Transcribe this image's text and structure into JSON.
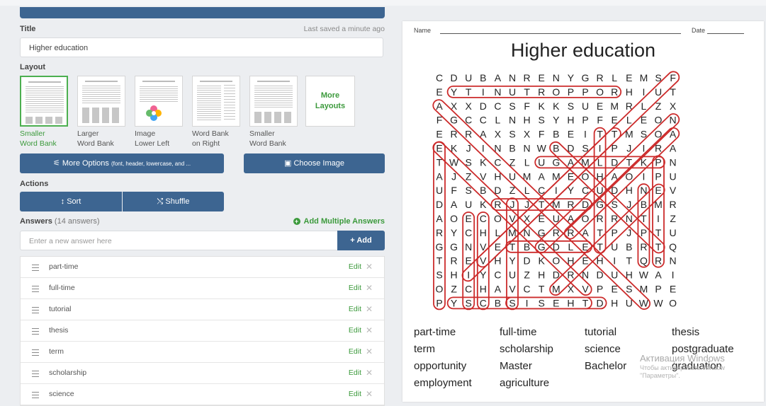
{
  "editor": {
    "title_label": "Title",
    "last_saved": "Last saved a minute ago",
    "title_value": "Higher education",
    "layout_label": "Layout",
    "layouts": [
      {
        "line1": "Smaller",
        "line2": "Word Bank",
        "selected": true
      },
      {
        "line1": "Larger",
        "line2": "Word Bank",
        "selected": false
      },
      {
        "line1": "Image",
        "line2": "Lower Left",
        "selected": false
      },
      {
        "line1": "Word Bank",
        "line2": "on Right",
        "selected": false
      },
      {
        "line1": "Smaller",
        "line2": "Word Bank",
        "selected": false
      }
    ],
    "more_layouts_1": "More",
    "more_layouts_2": "Layouts",
    "more_options_label": "More Options",
    "more_options_hint": "(font, header, lowercase, and ...",
    "choose_image_label": "Choose Image",
    "actions_label": "Actions",
    "sort_label": "Sort",
    "shuffle_label": "Shuffle",
    "answers_label": "Answers",
    "answers_count": "(14 answers)",
    "add_multiple_label": "Add Multiple Answers",
    "answer_placeholder": "Enter a new answer here",
    "add_label": "Add",
    "edit_label": "Edit",
    "answers": [
      "part-time",
      "full-time",
      "tutorial",
      "thesis",
      "term",
      "scholarship",
      "science"
    ]
  },
  "worksheet": {
    "name_label": "Name",
    "date_label": "Date",
    "title": "Higher education",
    "grid": [
      "CDUBANRENYGRLEMSF",
      "EYTINUTROPPORHIUT",
      "AXXDCSFKKSUEMRLZX",
      "FGCCLNHSYHPFELEON",
      "ERRAXSXFBEITTMSOA",
      "EKJINBNWBDSIPJIRA",
      "TWSKCZLUGAMLDTKPN",
      "AJZVHUMAMEOHAOIPU",
      "UFSBDZLCIYCUDHNEV",
      "DAUKRJJTMRDGSJBMR",
      "AOECOVXEUAORRNTIZ",
      "RYCHLMNGRRATPJPTU",
      "GGNVETBGDLETUBRTQ",
      "TREVHYDKOHEHITQRN",
      "SHIYCUZHDRNDUHWAI",
      "OZCHAVCTMXVPESMPE",
      "PYSCBSISEHTDHUWWO"
    ],
    "word_bank": [
      [
        "part-time",
        "full-time",
        "tutorial",
        "thesis"
      ],
      [
        "term",
        "scholarship",
        "science",
        "postgraduate"
      ],
      [
        "opportunity",
        "Master",
        "Bachelor",
        "graduation"
      ],
      [
        "employment",
        "agriculture"
      ]
    ]
  },
  "os_overlay": {
    "line1": "Активация Windows",
    "line2": "Чтобы активировать Window",
    "line3": "\"Параметры\"."
  },
  "colors": {
    "button_blue": "#3d6591",
    "accent_green": "#3c9a3c",
    "circle_red": "#cc2b2b"
  }
}
